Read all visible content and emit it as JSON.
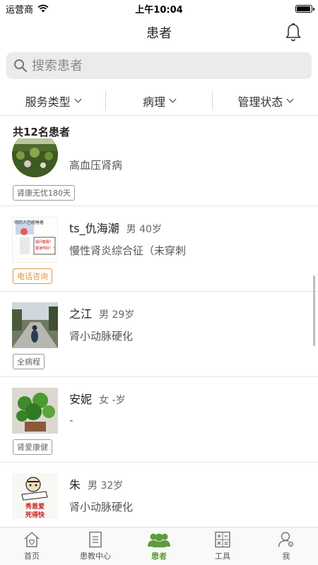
{
  "status_bar": {
    "carrier": "运营商",
    "time": "上午10:04",
    "battery_level": 0.95
  },
  "nav": {
    "title": "患者"
  },
  "search": {
    "placeholder": "搜索患者"
  },
  "filters": [
    {
      "label": "服务类型"
    },
    {
      "label": "病理"
    },
    {
      "label": "管理状态"
    }
  ],
  "count_text": "共12名患者",
  "patients": [
    {
      "name": "",
      "meta": "",
      "diagnosis": "高血压肾病",
      "tag": "肾康无忧180天",
      "tag_color": "#9a9a9a"
    },
    {
      "name": "ts_仇海潮",
      "meta": "男 40岁",
      "diagnosis": "慢性肾炎综合征（未穿刺",
      "tag": "电话咨询",
      "tag_color": "#e8913a",
      "avatar_text": [
        "待的人已经睡着",
        "提问客服！",
        "报道你好！！"
      ]
    },
    {
      "name": "之江",
      "meta": "男 29岁",
      "diagnosis": "肾小动脉硬化",
      "tag": "全病程",
      "tag_color": "#9a9a9a"
    },
    {
      "name": "安妮",
      "meta": "女 -岁",
      "diagnosis": "-",
      "tag": "肾爱康健",
      "tag_color": "#9a9a9a"
    },
    {
      "name": "朱",
      "meta": "男 32岁",
      "diagnosis": "肾小动脉硬化",
      "tag": "",
      "tag_color": "#9a9a9a",
      "avatar_text": [
        "秀恩爱",
        "死得快"
      ]
    }
  ],
  "tabs": [
    {
      "label": "首页",
      "icon": "home-icon"
    },
    {
      "label": "患教中心",
      "icon": "document-icon"
    },
    {
      "label": "患者",
      "icon": "patients-icon",
      "active": true
    },
    {
      "label": "工具",
      "icon": "calculator-icon"
    },
    {
      "label": "我",
      "icon": "profile-icon"
    }
  ],
  "colors": {
    "accent": "#5e9b3e",
    "tag_orange": "#e8913a"
  }
}
